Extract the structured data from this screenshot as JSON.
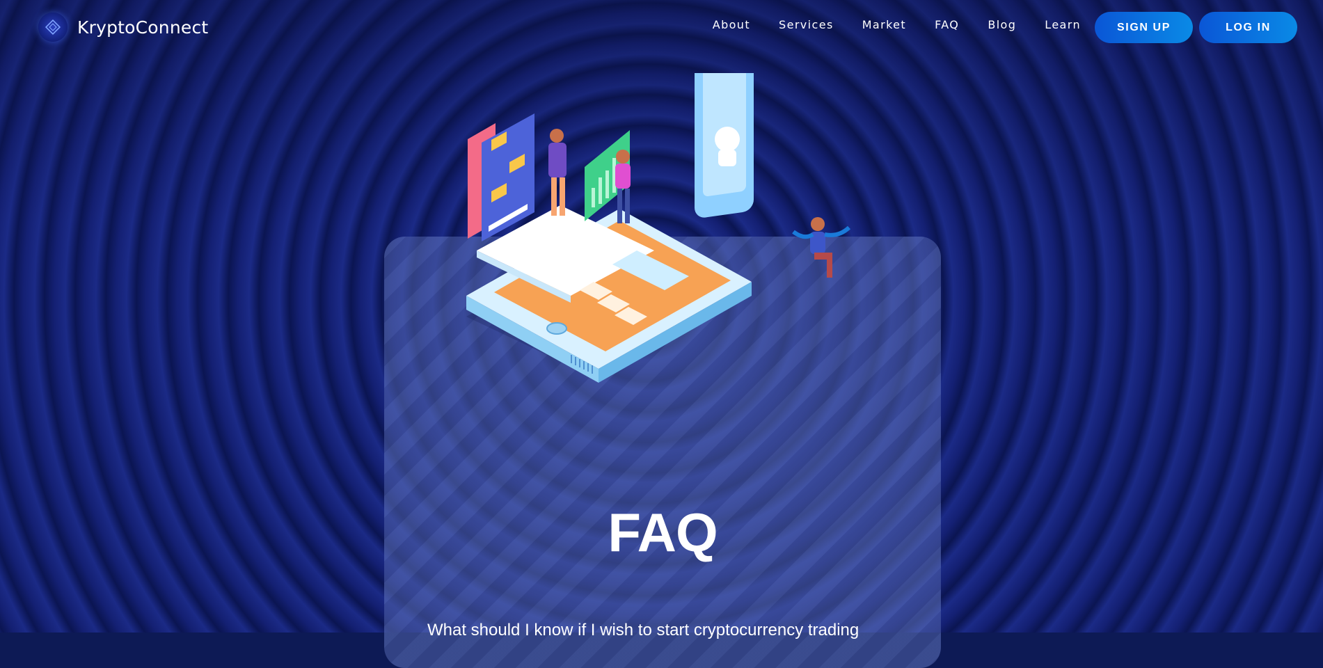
{
  "brand": {
    "name": "KryptoConnect",
    "logo_icon": "diamond-logo-icon"
  },
  "nav": {
    "items": [
      {
        "label": "About"
      },
      {
        "label": "Services"
      },
      {
        "label": "Market"
      },
      {
        "label": "FAQ"
      },
      {
        "label": "Blog"
      },
      {
        "label": "Learn"
      }
    ]
  },
  "auth": {
    "signup_label": "SIGN UP",
    "login_label": "LOG IN"
  },
  "hero": {
    "title": "FAQ",
    "question": "What should I know if I wish to start cryptocurrency trading"
  },
  "colors": {
    "background": "#0d1a55",
    "button": "#0a6fe0",
    "platform_orange": "#f7a254"
  }
}
